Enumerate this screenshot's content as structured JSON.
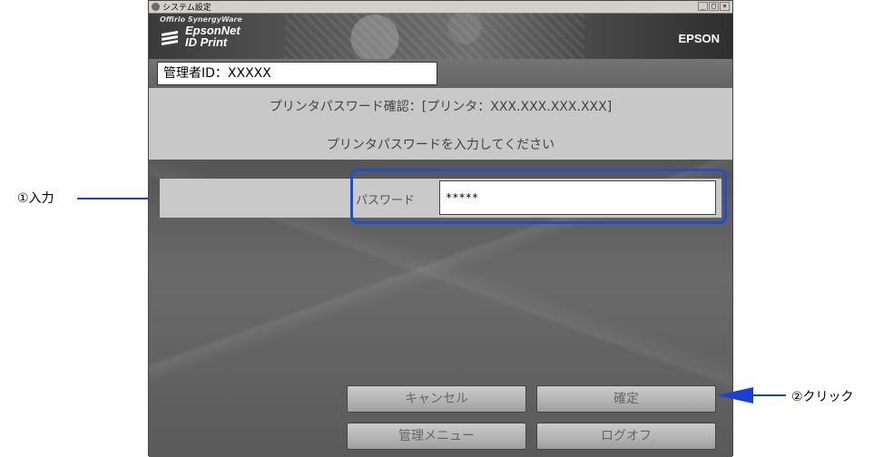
{
  "window": {
    "title": "システム設定",
    "controls": [
      "_",
      "□",
      "×"
    ]
  },
  "banner": {
    "suite": "Offirio SynergyWare",
    "product_line1": "EpsonNet",
    "product_line2": "ID Print",
    "brand": "EPSON"
  },
  "admin": {
    "id_label": "管理者ID：XXXXX"
  },
  "confirm": {
    "title": "プリンタパスワード確認：[プリンタ：XXX.XXX.XXX.XXX]",
    "prompt": "プリンタパスワードを入力してください"
  },
  "password": {
    "label": "パスワード",
    "value": "*****"
  },
  "buttons": {
    "cancel": "キャンセル",
    "ok": "確定",
    "menu": "管理メニュー",
    "logoff": "ログオフ"
  },
  "callouts": {
    "input": "①入力",
    "click": "②クリック"
  },
  "colors": {
    "accent": "#1a4fd6"
  }
}
